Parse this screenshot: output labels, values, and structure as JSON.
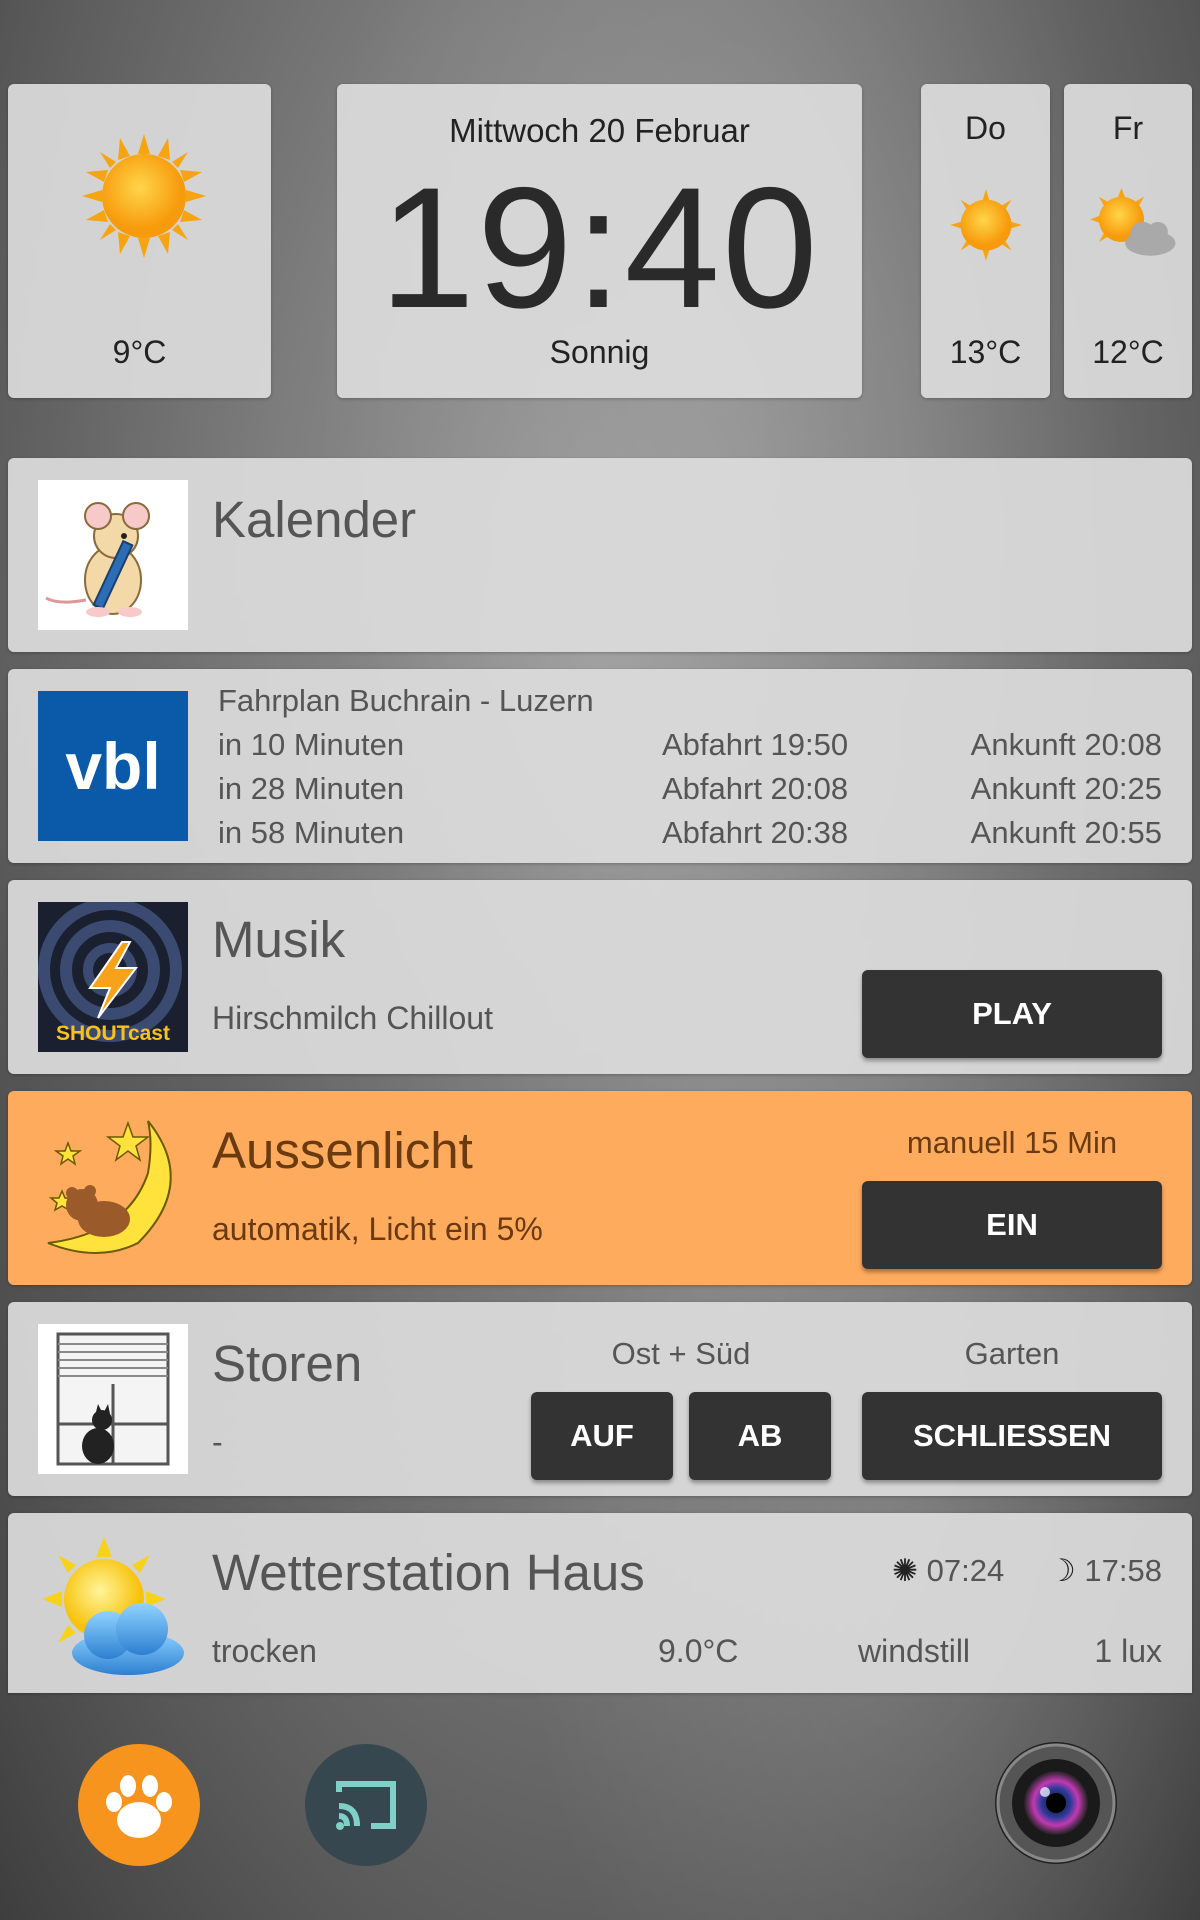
{
  "weather_today": {
    "temp": "9°C",
    "icon": "sun-icon"
  },
  "clock": {
    "date": "Mittwoch 20 Februar",
    "time": "19:40",
    "condition": "Sonnig"
  },
  "forecast": [
    {
      "day": "Do",
      "temp": "13°C",
      "icon": "sun-icon"
    },
    {
      "day": "Fr",
      "temp": "12°C",
      "icon": "sun-cloud-icon"
    }
  ],
  "calendar": {
    "title": "Kalender",
    "icon": "mouse-pencil-icon"
  },
  "timetable": {
    "title": "Fahrplan Buchrain - Luzern",
    "logo_text": "vbl",
    "rows": [
      {
        "in": "in 10 Minuten",
        "dep": "Abfahrt 19:50",
        "arr": "Ankunft 20:08"
      },
      {
        "in": "in 28 Minuten",
        "dep": "Abfahrt 20:08",
        "arr": "Ankunft 20:25"
      },
      {
        "in": "in 58 Minuten",
        "dep": "Abfahrt 20:38",
        "arr": "Ankunft 20:55"
      }
    ]
  },
  "music": {
    "title": "Musik",
    "station": "Hirschmilch Chillout",
    "play_label": "PLAY",
    "logo_text": "SHOUTcast"
  },
  "light": {
    "title": "Aussenlicht",
    "status": "automatik, Licht ein 5%",
    "manual_label": "manuell 15 Min",
    "button_label": "EIN",
    "accent": "#ffab5e"
  },
  "blinds": {
    "title": "Storen",
    "status": "-",
    "group1_label": "Ost + Süd",
    "up_label": "AUF",
    "down_label": "AB",
    "group2_label": "Garten",
    "close_label": "SCHLIESSEN"
  },
  "station": {
    "title": "Wetterstation Haus",
    "sunrise": "07:24",
    "sunset": "17:58",
    "rain": "trocken",
    "temp": "9.0°C",
    "wind": "windstill",
    "light": "1 lux"
  },
  "dock": [
    {
      "name": "paw-icon",
      "color": "#f7941d"
    },
    {
      "name": "cast-icon",
      "color": "#37474f"
    },
    {
      "name": "camera-icon",
      "color": "#222222"
    }
  ]
}
